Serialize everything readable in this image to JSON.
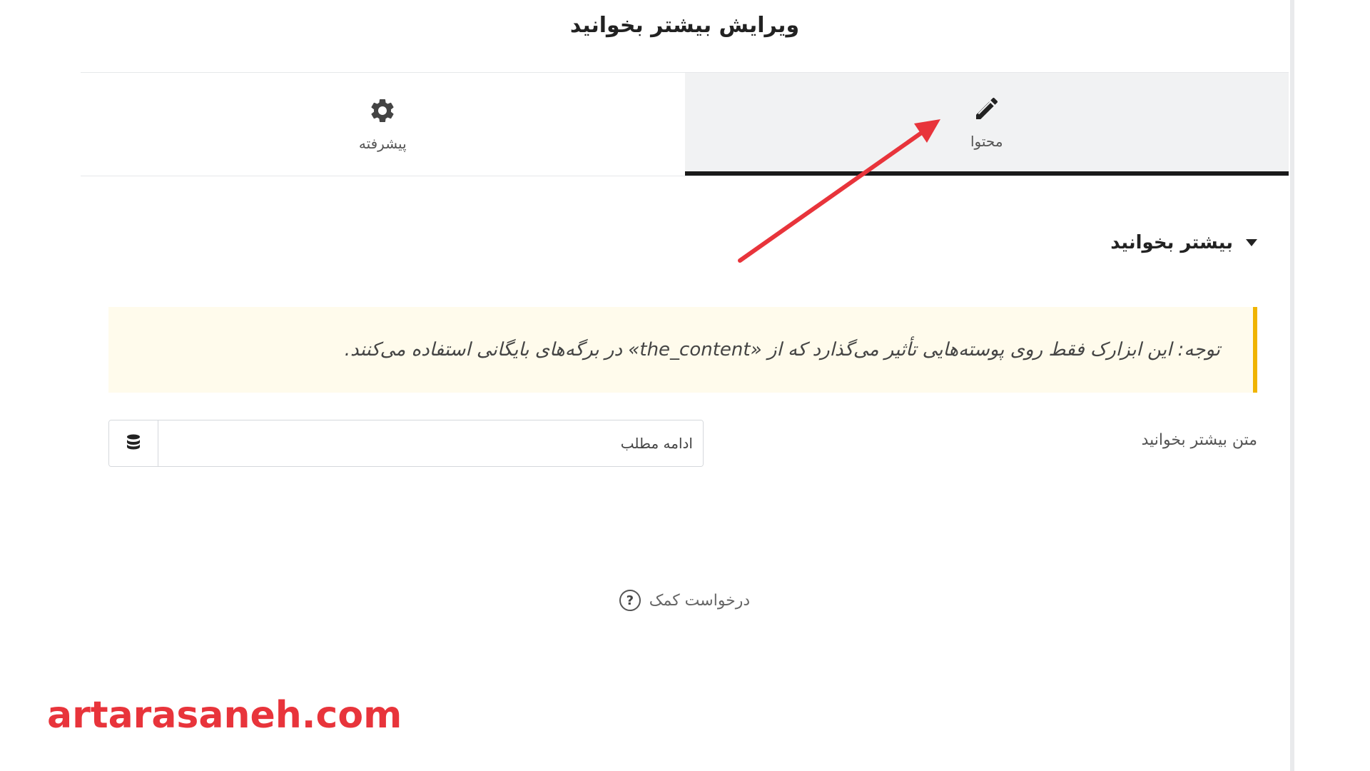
{
  "panel": {
    "title": "ویرایش بیشتر بخوانید"
  },
  "tabs": [
    {
      "id": "content",
      "label": "محتوا",
      "icon": "pencil-icon",
      "active": true
    },
    {
      "id": "advanced",
      "label": "پیشرفته",
      "icon": "gear-icon",
      "active": false
    }
  ],
  "section": {
    "title": "بیشتر بخوانید"
  },
  "notice": {
    "text": "توجه: این ابزارک فقط روی پوسته‌هایی تأثیر می‌گذارد که از «the_content» در برگه‌های بایگانی استفاده می‌کنند."
  },
  "field": {
    "label": "متن بیشتر بخوانید",
    "value": "ادامه مطلب",
    "dynamic_icon": "database-icon"
  },
  "help": {
    "label": "درخواست کمک"
  },
  "watermark": {
    "text": "artarasaneh.com"
  },
  "colors": {
    "accent_arrow": "#e8343b",
    "notice_border": "#f0b400",
    "notice_bg": "#fffbec",
    "active_tab_bg": "#f1f2f3",
    "watermark": "#e8343b"
  }
}
